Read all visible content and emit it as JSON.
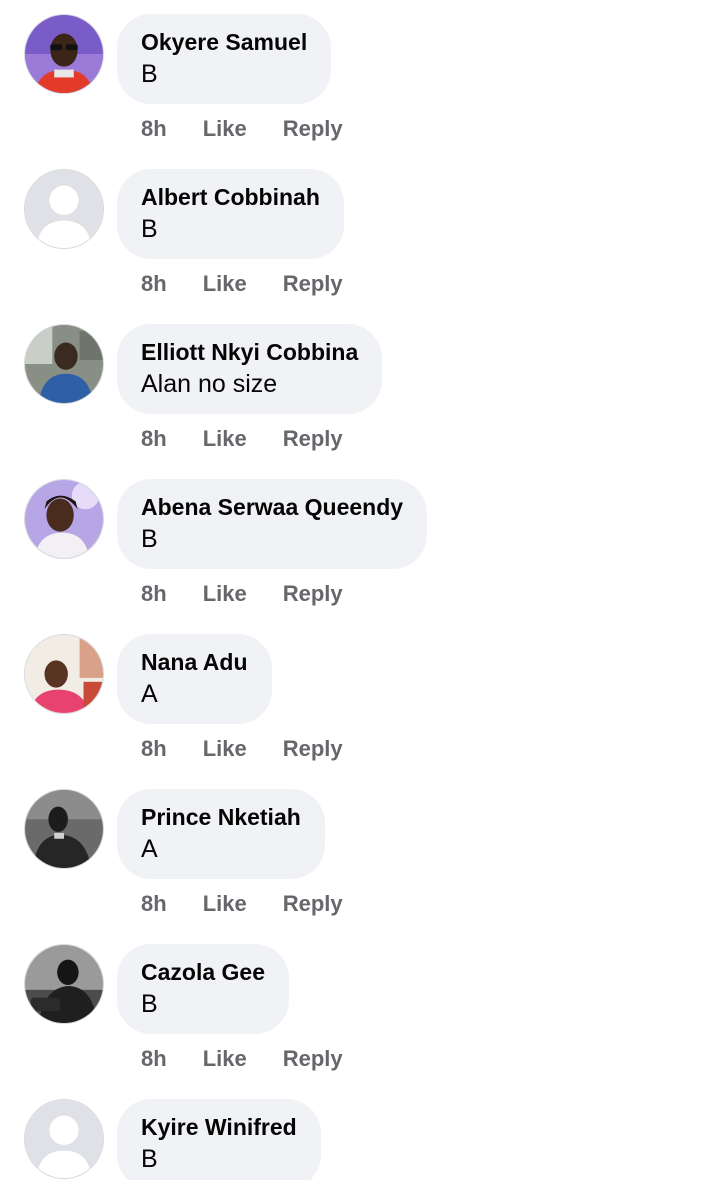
{
  "comments": [
    {
      "author": "Okyere Samuel",
      "text": "B",
      "time": "8h",
      "like": "Like",
      "reply": "Reply",
      "avatar": "photo-man-red-shirt"
    },
    {
      "author": "Albert Cobbinah",
      "text": "B",
      "time": "8h",
      "like": "Like",
      "reply": "Reply",
      "avatar": "default-silhouette"
    },
    {
      "author": "Elliott Nkyi Cobbina",
      "text": "Alan no size",
      "time": "8h",
      "like": "Like",
      "reply": "Reply",
      "avatar": "photo-man-car"
    },
    {
      "author": "Abena Serwaa Queendy",
      "text": "B",
      "time": "8h",
      "like": "Like",
      "reply": "Reply",
      "avatar": "photo-woman-purple"
    },
    {
      "author": "Nana Adu",
      "text": "A",
      "time": "8h",
      "like": "Like",
      "reply": "Reply",
      "avatar": "photo-person-pink"
    },
    {
      "author": "Prince Nketiah",
      "text": "A",
      "time": "8h",
      "like": "Like",
      "reply": "Reply",
      "avatar": "photo-man-bw"
    },
    {
      "author": "Cazola Gee",
      "text": "B",
      "time": "8h",
      "like": "Like",
      "reply": "Reply",
      "avatar": "photo-man-bw-dark"
    },
    {
      "author": "Kyire Winifred",
      "text": "B",
      "time": "",
      "like": "",
      "reply": "",
      "avatar": "default-silhouette"
    }
  ],
  "colors": {
    "bubble": "#f0f2f5",
    "text": "#050505",
    "meta": "#65676b"
  }
}
